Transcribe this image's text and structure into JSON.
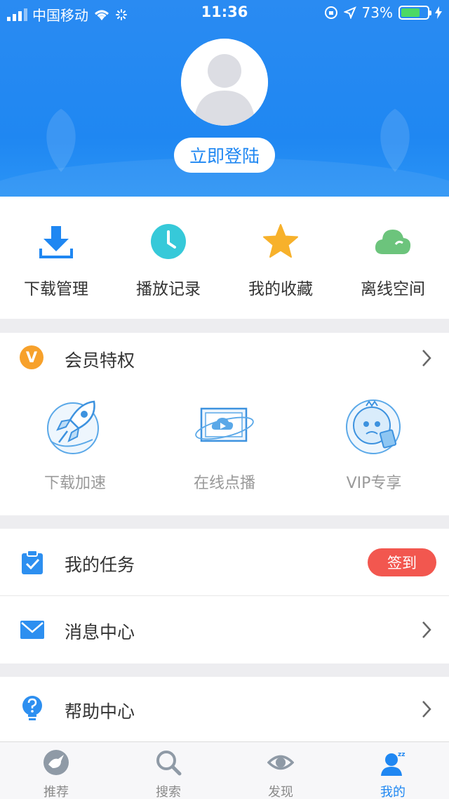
{
  "status_bar": {
    "carrier": "中国移动",
    "time": "11:36",
    "battery_percent": "73%",
    "battery_level": 0.73
  },
  "profile": {
    "login_label": "立即登陆"
  },
  "shortcuts": [
    {
      "label": "下载管理",
      "icon": "download-icon"
    },
    {
      "label": "播放记录",
      "icon": "clock-icon"
    },
    {
      "label": "我的收藏",
      "icon": "star-icon"
    },
    {
      "label": "离线空间",
      "icon": "cloud-icon"
    }
  ],
  "vip": {
    "badge": "V",
    "title": "会员特权",
    "items": [
      {
        "label": "下载加速",
        "icon": "rocket-icon"
      },
      {
        "label": "在线点播",
        "icon": "video-screen-icon"
      },
      {
        "label": "VIP专享",
        "icon": "vip-mascot-icon"
      }
    ]
  },
  "list": {
    "tasks_label": "我的任务",
    "checkin_label": "签到",
    "messages_label": "消息中心",
    "help_label": "帮助中心"
  },
  "tabs": [
    {
      "label": "推荐",
      "icon": "bird-icon",
      "active": false
    },
    {
      "label": "搜索",
      "icon": "search-icon",
      "active": false
    },
    {
      "label": "发现",
      "icon": "eye-icon",
      "active": false
    },
    {
      "label": "我的",
      "icon": "user-sleep-icon",
      "active": true
    }
  ],
  "colors": {
    "header_blue": "#1f87f2",
    "vip_orange": "#f7a12b",
    "checkin_red": "#f2574f",
    "teal": "#36c9d9",
    "star": "#f7b12b",
    "cloud": "#6cc47c"
  }
}
